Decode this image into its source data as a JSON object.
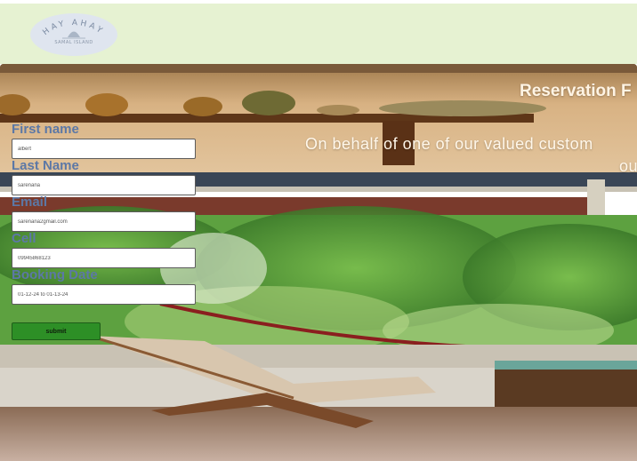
{
  "header": {
    "logo_text": "HAY AHAY",
    "logo_subtext": "SAMAL ISLAND"
  },
  "hero": {
    "title": "Reservation F",
    "intro_line1": "On behalf of one of our valued custom",
    "intro_line2": "ou"
  },
  "form": {
    "fields": [
      {
        "label": "First name",
        "value": "albert"
      },
      {
        "label": "Last Name",
        "value": "sarenana"
      },
      {
        "label": "Email",
        "value": "sarenana2gmail.com"
      },
      {
        "label": "Cell",
        "value": "09945868123"
      },
      {
        "label": "Booking Date",
        "value": "01-12-24 to 01-13-24"
      }
    ],
    "submit_label": "submit"
  },
  "colors": {
    "header_bg": "#e6f2d2",
    "label_color": "#5c78a6",
    "button_bg": "#2d8f26"
  }
}
